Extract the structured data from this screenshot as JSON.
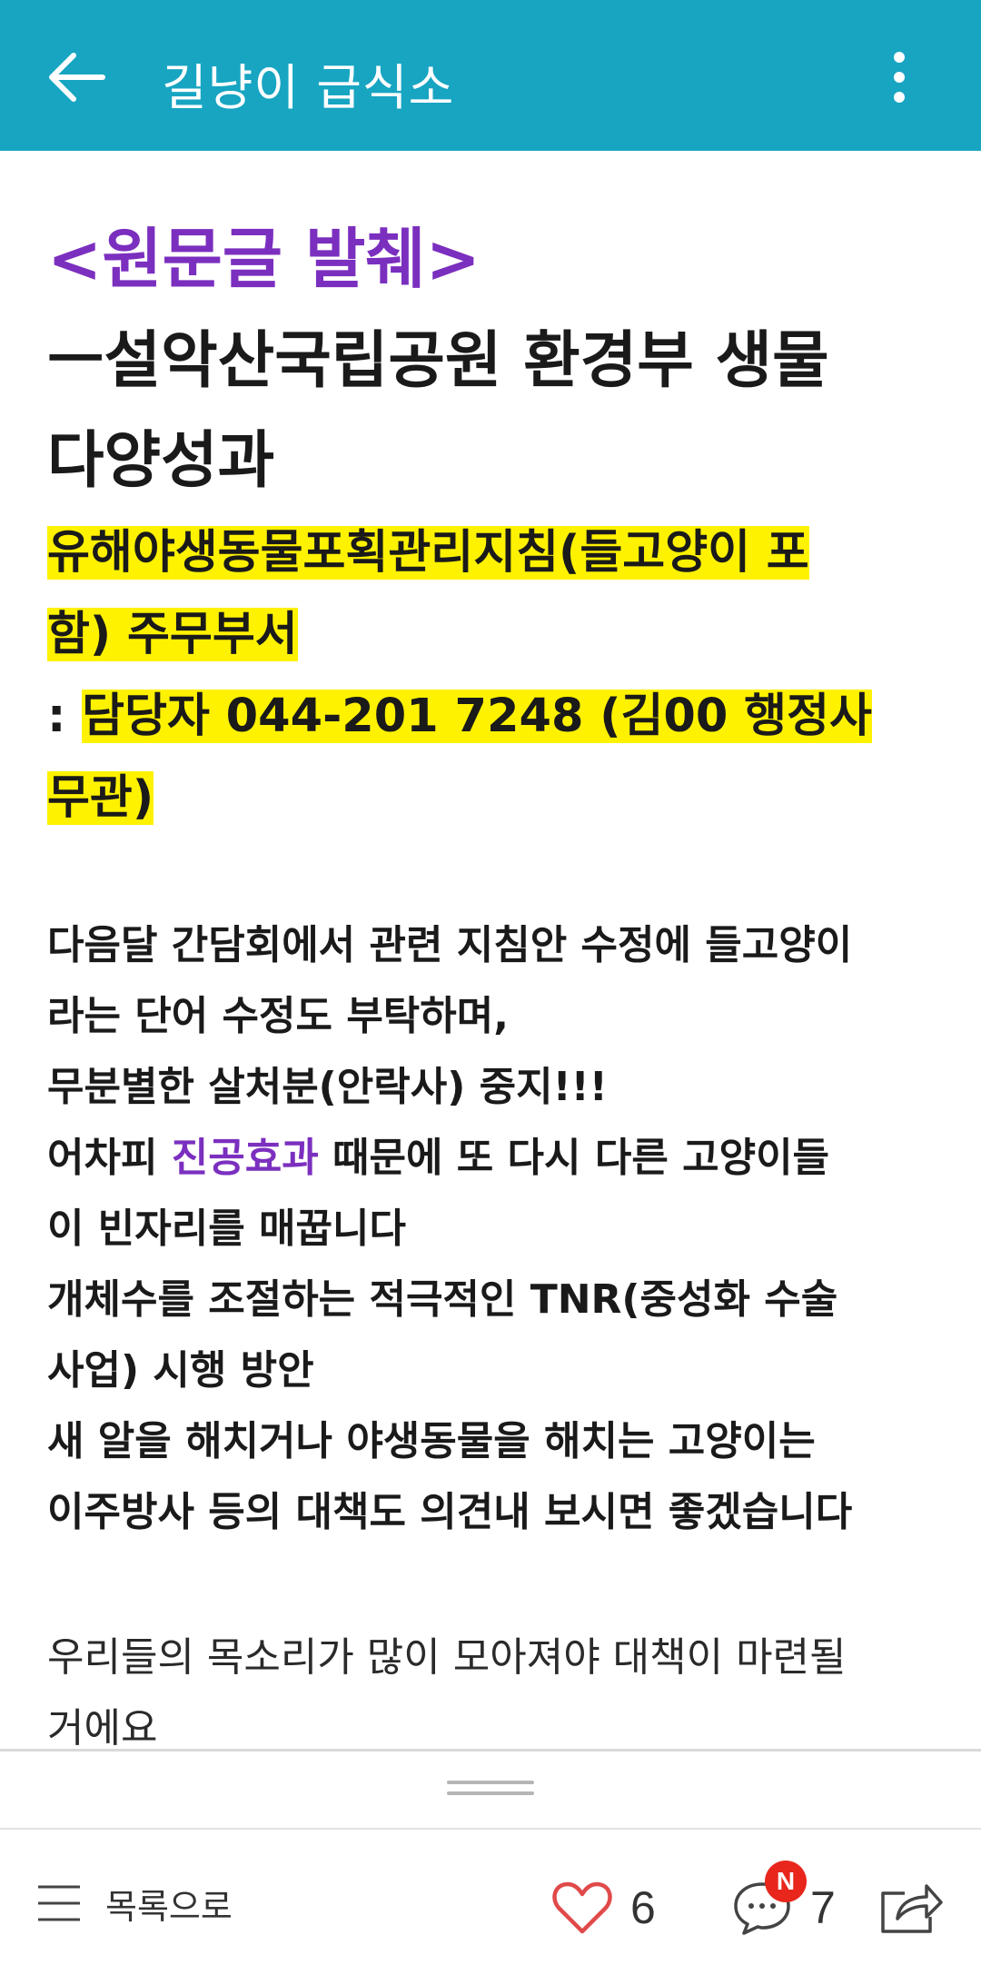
{
  "appbar": {
    "title": "길냥이 급식소"
  },
  "post": {
    "lines": [
      {
        "text": "<원문글 발췌>"
      },
      {
        "text": "ㅡ설악산국립공원 환경부 생물"
      },
      {
        "text": "다양성과"
      },
      {
        "text": "유해야생동물포획관리지침(들고양이 포"
      },
      {
        "text": "함) 주무부서"
      },
      {
        "prefix": ": ",
        "text": "담당자 044-201 7248 (김00 행정사"
      },
      {
        "text": "무관)"
      },
      {
        "text": "다음달 간담회에서 관련 지침안 수정에 들고양이"
      },
      {
        "text": "라는 단어 수정도 부탁하며,"
      },
      {
        "text": "무분별한 살처분(안락사) 중지!!!"
      },
      {
        "prefix": "어차피 ",
        "highlight": "진공효과",
        "suffix": " 때문에  또 다시 다른 고양이들"
      },
      {
        "text": "이 빈자리를 매꿉니다"
      },
      {
        "text": "개체수를 조절하는 적극적인 TNR(중성화 수술"
      },
      {
        "text": "사업) 시행 방안"
      },
      {
        "text": "새 알을 해치거나 야생동물을 해치는 고양이는"
      },
      {
        "text": "이주방사 등의 대책도 의견내 보시면 좋겠습니다"
      },
      {
        "text": "우리들의 목소리가 많이 모아져야 대책이 마련될"
      },
      {
        "text": "거에요"
      }
    ]
  },
  "bottombar": {
    "list_label": "목록으로",
    "like_count": "6",
    "comment_count": "7",
    "comment_badge": "N"
  },
  "colors": {
    "appbar": "#17a5c2",
    "accent_purple": "#7b2fbf",
    "highlight_yellow": "#fff200",
    "badge_red": "#e8261c"
  },
  "icons": [
    "back-arrow-icon",
    "more-vertical-icon",
    "list-icon",
    "heart-icon",
    "comment-icon",
    "share-icon"
  ]
}
